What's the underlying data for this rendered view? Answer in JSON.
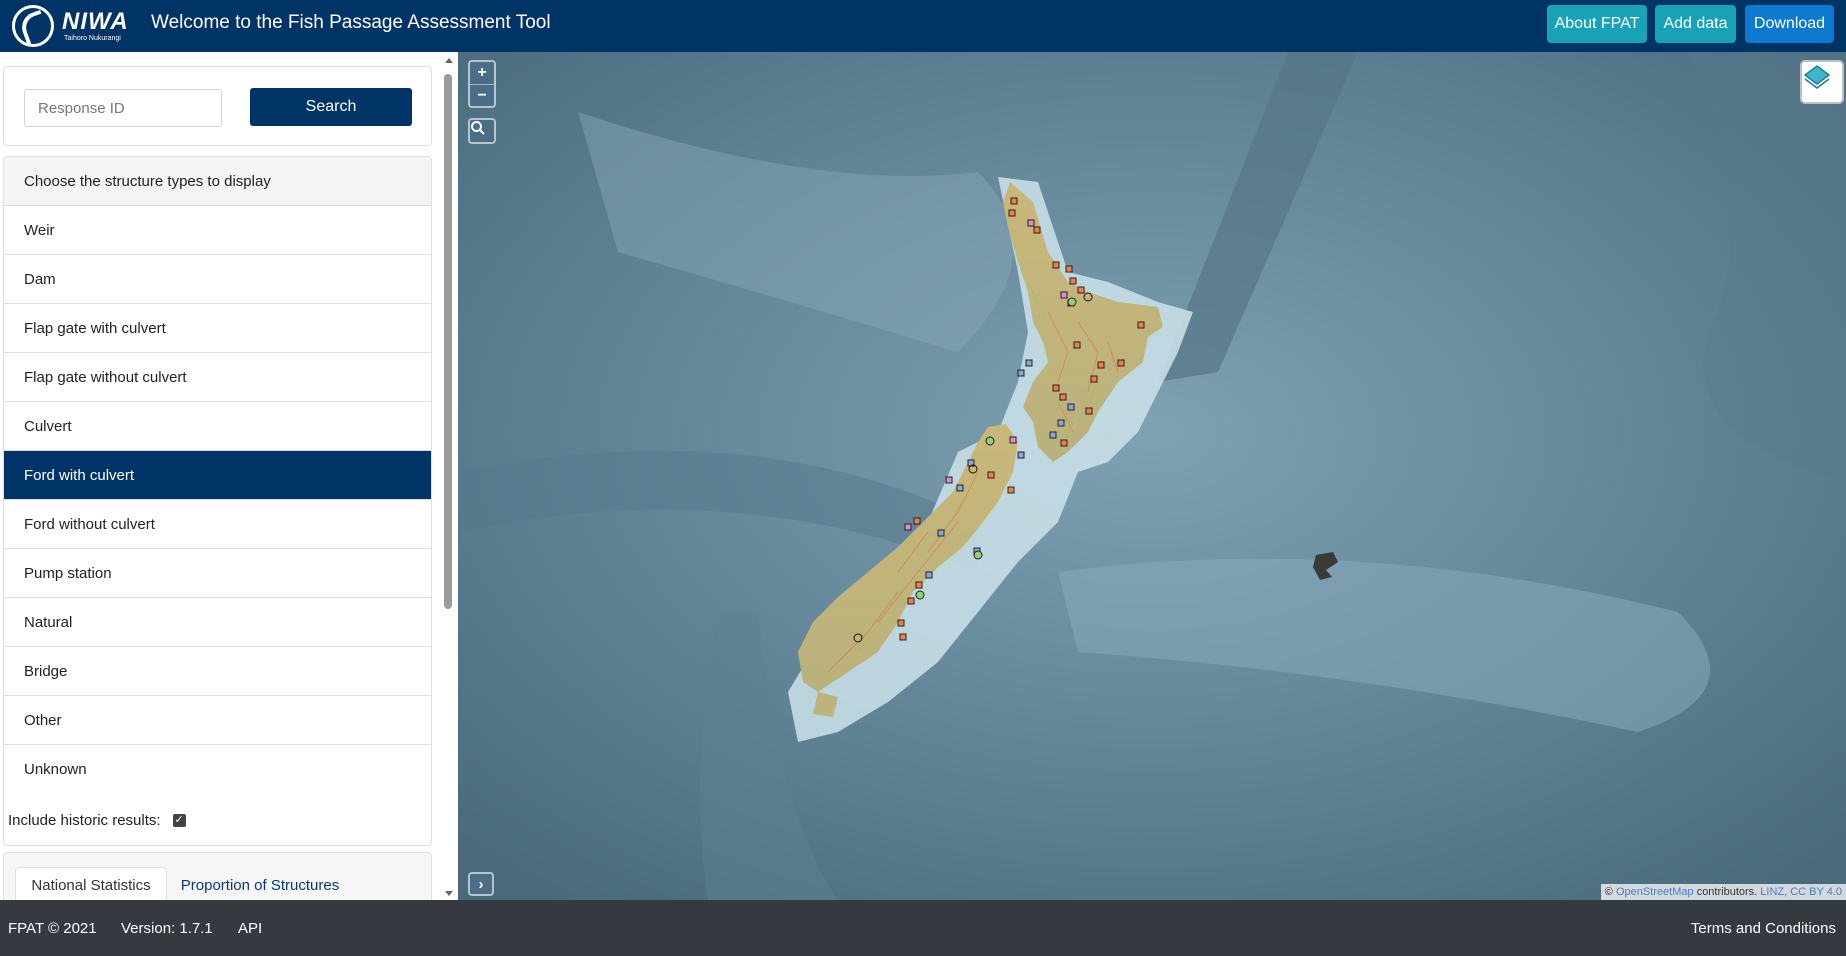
{
  "header": {
    "logo_name": "NIWA",
    "logo_subtitle": "Taihoro Nukurangi",
    "title": "Welcome to the Fish Passage Assessment Tool",
    "buttons": {
      "about": "About FPAT",
      "add_data": "Add data",
      "download": "Download"
    },
    "colors": {
      "bar": "#003366",
      "teal": "#17a2b8",
      "blue": "#0d7ad0"
    }
  },
  "sidebar": {
    "search": {
      "placeholder": "Response ID",
      "value": "",
      "button": "Search"
    },
    "structures": {
      "header": "Choose the structure types to display",
      "items": [
        "Weir",
        "Dam",
        "Flap gate with culvert",
        "Flap gate without culvert",
        "Culvert",
        "Ford with culvert",
        "Ford without culvert",
        "Pump station",
        "Natural",
        "Bridge",
        "Other",
        "Unknown"
      ],
      "selected": "Ford with culvert"
    },
    "historic": {
      "label": "Include historic results:",
      "checked": true
    },
    "tabs": [
      "National Statistics",
      "Proportion of Structures"
    ]
  },
  "map": {
    "zoom_in": "+",
    "zoom_out": "−",
    "expand": "›",
    "attribution": {
      "prefix": "©",
      "osm": "OpenStreetMap",
      "contributors": "contributors.",
      "linz": "LINZ, CC BY 4.0"
    },
    "icons": [
      "search-icon",
      "layers-icon"
    ]
  },
  "footer": {
    "copyright": "FPAT © 2021",
    "version": "Version: 1.7.1",
    "api": "API",
    "terms": "Terms and Conditions"
  }
}
